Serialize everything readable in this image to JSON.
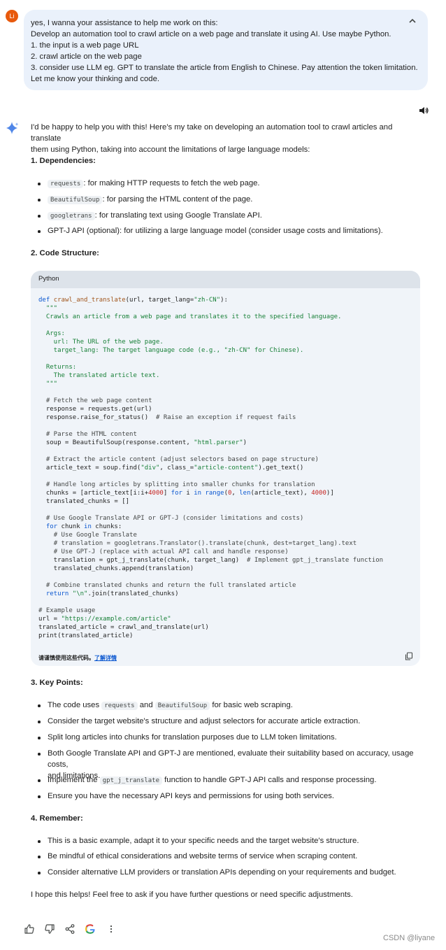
{
  "user": {
    "avatar_initials": "Li",
    "prompt_lines": [
      "yes, I wanna your assistance to help me work on this:",
      "Develop an automation tool to crawl article on a web page and translate it using AI. Use maybe Python.",
      "1. the input is a web page URL",
      "2. crawl article on the web page",
      "3. consider use LLM eg. GPT to translate the article from English to Chinese. Pay attention the token limitation.",
      "Let me know your thinking and code."
    ]
  },
  "response": {
    "intro_line1": "I'd be happy to help you with this! Here's my take on developing an automation tool to crawl articles and translate",
    "intro_line2": "them using Python, taking into account the limitations of large language models:",
    "section1_heading": "1. Dependencies:",
    "deps": [
      {
        "code": "requests",
        "text": ": for making HTTP requests to fetch the web page."
      },
      {
        "code": "BeautifulSoup",
        "text": ": for parsing the HTML content of the page."
      },
      {
        "code": "googletrans",
        "text": ": for translating text using Google Translate API."
      },
      {
        "code": "",
        "text": "GPT-J API (optional): for utilizing a large language model (consider usage costs and limitations)."
      }
    ],
    "section2_heading": "2. Code Structure:",
    "code_language": "Python",
    "code_footer_text": "请谨慎使用这些代码。",
    "code_footer_link": "了解详情",
    "section3_heading": "3. Key Points:",
    "key_points": {
      "p1_pre": "The code uses ",
      "p1_code1": "requests",
      "p1_mid": " and ",
      "p1_code2": "BeautifulSoup",
      "p1_post": " for basic web scraping.",
      "p2": "Consider the target website's structure and adjust selectors for accurate article extraction.",
      "p3": "Split long articles into chunks for translation purposes due to LLM token limitations.",
      "p4_line1": "Both Google Translate API and GPT-J are mentioned, evaluate their suitability based on accuracy, usage costs,",
      "p4_line2": "and limitations.",
      "p5_pre": "Implement the ",
      "p5_code": "gpt_j_translate",
      "p5_post": " function to handle GPT-J API calls and response processing.",
      "p6": "Ensure you have the necessary API keys and permissions for using both services."
    },
    "section4_heading": "4. Remember:",
    "remember": [
      "This is a basic example, adapt it to your specific needs and the target website's structure.",
      "Be mindful of ethical considerations and website terms of service when scraping content.",
      "Consider alternative LLM providers or translation APIs depending on your requirements and budget."
    ],
    "closing": "I hope this helps! Feel free to ask if you have further questions or need specific adjustments."
  },
  "watermark": "CSDN @liyane",
  "icons": [
    "chevron-up-icon",
    "speaker-icon",
    "gemini-sparkle-icon",
    "copy-icon",
    "thumbs-up-icon",
    "thumbs-down-icon",
    "share-icon",
    "google-icon",
    "more-vert-icon"
  ],
  "colors": {
    "prompt_bg": "#eaf1fb",
    "code_bg": "#f0f4f9",
    "code_header": "#dde3ea",
    "avatar": "#e8590c",
    "link": "#0b57d0"
  }
}
